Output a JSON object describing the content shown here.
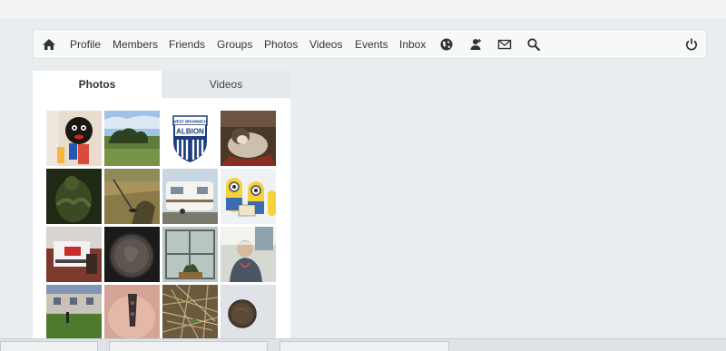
{
  "navbar": {
    "home_icon": "home-icon",
    "links": [
      "Profile",
      "Members",
      "Friends",
      "Groups",
      "Photos",
      "Videos",
      "Events",
      "Inbox"
    ],
    "icons": [
      "globe-icon",
      "user-add-icon",
      "mail-icon",
      "search-icon",
      "power-icon"
    ]
  },
  "media_panel": {
    "tabs": [
      "Photos",
      "Videos"
    ],
    "active_tab": "Photos"
  },
  "photos": [
    {
      "subject": "knitted doll with toy"
    },
    {
      "subject": "field with hedge under blue sky"
    },
    {
      "subject": "West Bromwich Albion crest"
    },
    {
      "subject": "husky dog on rug"
    },
    {
      "subject": "person in camouflage"
    },
    {
      "subject": "field with detector and shadow"
    },
    {
      "subject": "caravan on driveway"
    },
    {
      "subject": "minions"
    },
    {
      "subject": "coin in box"
    },
    {
      "subject": "old coin close-up"
    },
    {
      "subject": "window with plant"
    },
    {
      "subject": "man holding find"
    },
    {
      "subject": "house garden"
    },
    {
      "subject": "hand holding artifact"
    },
    {
      "subject": "straw and dirt"
    },
    {
      "subject": "coin on cloth"
    }
  ],
  "crest_text": {
    "line1": "WEST BROMWICH",
    "line2": "ALBION"
  },
  "colors": {
    "background": "#e9edf0",
    "navbar": "#f7f8f8",
    "panel": "#ffffff",
    "inactive_tab": "#e4e9ec"
  }
}
